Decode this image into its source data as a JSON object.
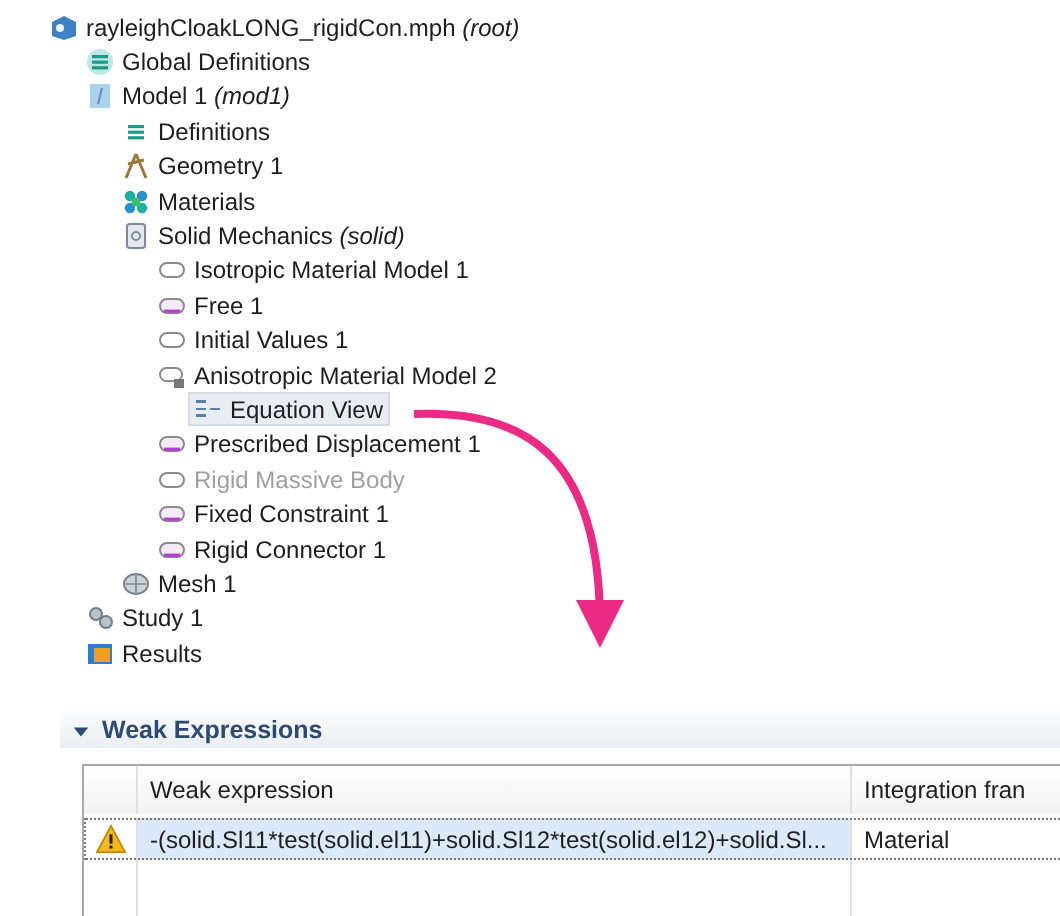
{
  "tree": {
    "label": "rayleighCloakLONG_rigidCon.mph *(root)*",
    "kind": "file",
    "selected": false,
    "disabled": false,
    "children": [
      {
        "label": "Global Definitions",
        "kind": "global",
        "selected": false,
        "disabled": false
      },
      {
        "label": "Model 1 *(mod1)*",
        "kind": "model",
        "selected": false,
        "disabled": false,
        "children": [
          {
            "label": "Definitions",
            "kind": "definitions",
            "selected": false,
            "disabled": false
          },
          {
            "label": "Geometry 1",
            "kind": "geometry",
            "selected": false,
            "disabled": false
          },
          {
            "label": "Materials",
            "kind": "materials",
            "selected": false,
            "disabled": false
          },
          {
            "label": "Solid Mechanics *(solid)*",
            "kind": "physics",
            "selected": false,
            "disabled": false,
            "children": [
              {
                "label": "Isotropic Material Model 1",
                "kind": "domain",
                "selected": false,
                "disabled": false
              },
              {
                "label": "Free 1",
                "kind": "boundary",
                "selected": false,
                "disabled": false
              },
              {
                "label": "Initial Values 1",
                "kind": "domain",
                "selected": false,
                "disabled": false
              },
              {
                "label": "Anisotropic Material Model 2",
                "kind": "locked",
                "selected": false,
                "disabled": false,
                "children": [
                  {
                    "label": "Equation View",
                    "kind": "equation",
                    "selected": true,
                    "disabled": false
                  }
                ]
              },
              {
                "label": "Prescribed Displacement 1",
                "kind": "boundary",
                "selected": false,
                "disabled": false
              },
              {
                "label": "Rigid Massive Body",
                "kind": "domain",
                "selected": false,
                "disabled": true
              },
              {
                "label": "Fixed Constraint 1",
                "kind": "boundary",
                "selected": false,
                "disabled": false
              },
              {
                "label": "Rigid Connector 1",
                "kind": "boundary",
                "selected": false,
                "disabled": false
              }
            ]
          },
          {
            "label": "Mesh 1",
            "kind": "mesh",
            "selected": false,
            "disabled": false
          }
        ]
      },
      {
        "label": "Study 1",
        "kind": "study",
        "selected": false,
        "disabled": false
      },
      {
        "label": "Results",
        "kind": "results",
        "selected": false,
        "disabled": false
      }
    ]
  },
  "weak_expressions": {
    "title": "Weak Expressions",
    "expanded": true,
    "columns": [
      "Weak expression",
      "Integration fran"
    ],
    "rows": [
      {
        "kind": "warning",
        "expression": "-(solid.Sl11*test(solid.el11)+solid.Sl12*test(solid.el12)+solid.Sl...",
        "frame": "Material",
        "selected": true
      }
    ]
  }
}
